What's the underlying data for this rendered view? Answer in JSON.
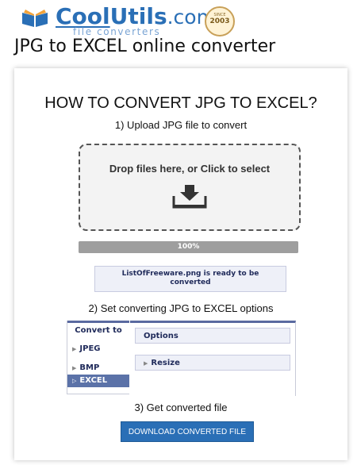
{
  "header": {
    "logo": {
      "cool": "Cool",
      "utils": "Utils",
      "dotcom": ".com",
      "subtitle": "file converters"
    },
    "since_badge": {
      "since": "SINCE",
      "year": "2003"
    },
    "page_title": "JPG to EXCEL online converter"
  },
  "main": {
    "how_title": "HOW TO CONVERT JPG TO EXCEL?",
    "step1": "1) Upload JPG file to convert",
    "dropzone": {
      "label": "Drop files here, or Click to select",
      "icon": "download-icon"
    },
    "progress": {
      "label": "100%",
      "value": 100
    },
    "ready_message": "ListOfFreeware.png is ready to be converted",
    "step2": "2) Set converting JPG to EXCEL options",
    "convert_to": {
      "header": "Convert to",
      "items": [
        {
          "label": "JPEG",
          "active": false
        },
        {
          "label": "BMP",
          "active": false
        },
        {
          "label": "EXCEL",
          "active": true
        }
      ]
    },
    "options": {
      "header": "Options",
      "sections": [
        {
          "label": "Resize"
        }
      ]
    },
    "step3": "3) Get converted file",
    "download_button": "DOWNLOAD CONVERTED FILE"
  },
  "colors": {
    "brand_blue": "#2a6fb6",
    "active_tab": "#5b72a8",
    "progress_bar": "#a6a6a6"
  }
}
